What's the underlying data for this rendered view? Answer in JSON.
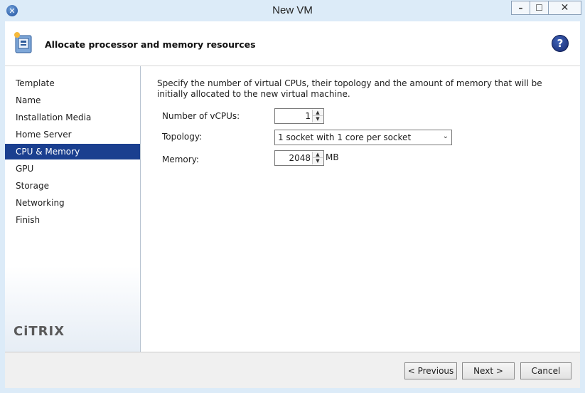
{
  "window": {
    "title": "New VM",
    "app_icon": "close-circle-icon",
    "controls": {
      "minimize": "–",
      "maximize": "☐",
      "close": "✕"
    }
  },
  "header": {
    "title": "Allocate processor and memory resources",
    "help_symbol": "?"
  },
  "nav": {
    "items": [
      {
        "label": "Template"
      },
      {
        "label": "Name"
      },
      {
        "label": "Installation Media"
      },
      {
        "label": "Home Server"
      },
      {
        "label": "CPU & Memory",
        "selected": true
      },
      {
        "label": "GPU"
      },
      {
        "label": "Storage"
      },
      {
        "label": "Networking"
      },
      {
        "label": "Finish"
      }
    ],
    "logo": "CiTRIX"
  },
  "main": {
    "description": "Specify the number of virtual CPUs, their topology and the amount of memory that will be initially allocated to the new virtual machine.",
    "vcpus": {
      "label": "Number of vCPUs:",
      "value": "1"
    },
    "topology": {
      "label": "Topology:",
      "value": "1 socket with 1 core per socket"
    },
    "memory": {
      "label": "Memory:",
      "value": "2048",
      "unit": "MB"
    }
  },
  "footer": {
    "previous_label": "< Previous",
    "next_label": "Next >",
    "cancel_label": "Cancel"
  },
  "colors": {
    "selected_nav": "#1a3f8f",
    "chrome": "#dcebf8",
    "help": "#15286e"
  }
}
